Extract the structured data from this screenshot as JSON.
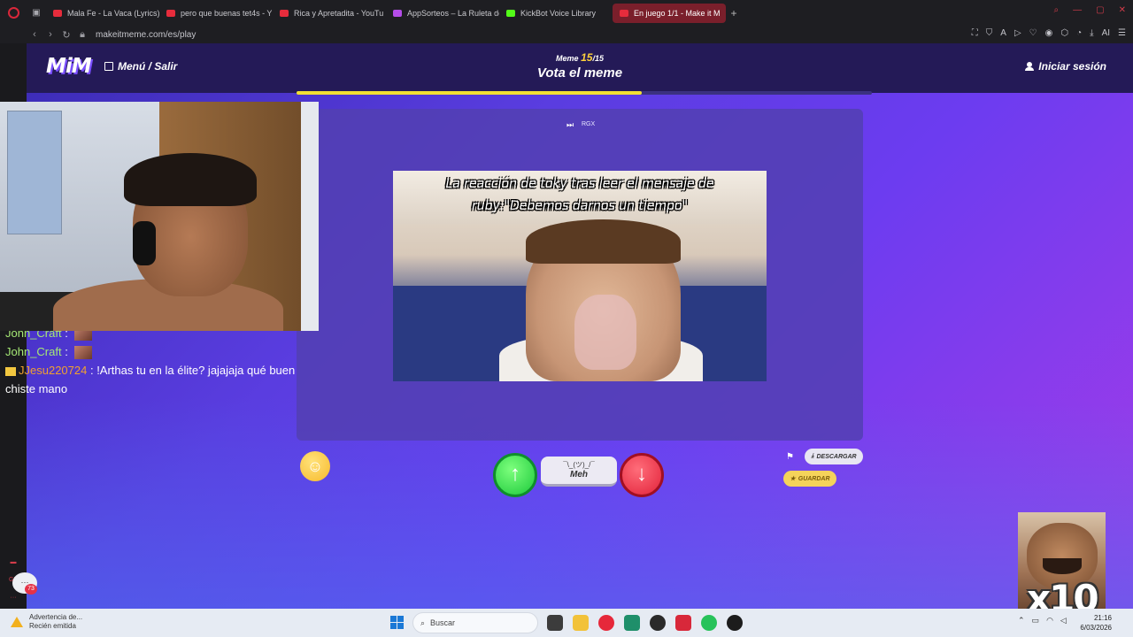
{
  "browser": {
    "tabs": [
      {
        "label": "Mala Fe - La Vaca (Lyrics)",
        "color": "#e62c3c"
      },
      {
        "label": "pero que buenas tet4s - Y",
        "color": "#e62c3c"
      },
      {
        "label": "Rica y Apretadita - YouTu",
        "color": "#e62c3c"
      },
      {
        "label": "AppSorteos – La Ruleta de",
        "color": "#b44ce8"
      },
      {
        "label": "KickBot Voice Library",
        "color": "#53fc18"
      },
      {
        "label": "En juego 1/1 - Make it M",
        "color": "#e62c3c"
      }
    ],
    "url": "makeitmeme.com/es/play",
    "ai_label": "AI"
  },
  "header": {
    "logo": "MiM",
    "menu_label": "Menú / Salir",
    "counter_prefix": "Meme",
    "counter_current": "15",
    "counter_total": "/15",
    "title": "Vota el meme",
    "login_label": "Iniciar sesión",
    "progress": 0.6
  },
  "meme": {
    "rgx_label": "RGX",
    "caption": "La reacción de toky tras leer el mensaje de ruby:\"Debemos darnos un tiempo\""
  },
  "actions": {
    "meh_shrug": "¯\\_(ツ)_/¯",
    "meh_label": "Meh",
    "download_label": "DESCARGAR",
    "save_label": "GUARDAR"
  },
  "chat": [
    {
      "user": "John_Craft",
      "text": ""
    },
    {
      "user": "John_Craft",
      "text": ""
    },
    {
      "user": "JJesu220724",
      "text": "!Arthas tu en la élite? jajajaja qué buen"
    },
    {
      "user": "",
      "text": "chiste mano"
    }
  ],
  "overlay": {
    "bubble_count": "73",
    "multiplier": "x10"
  },
  "taskbar": {
    "notif_title": "Advertencia de...",
    "notif_sub": "Recién emitida",
    "search_label": "Buscar",
    "time": "21:16",
    "date": "6/03/2026"
  }
}
